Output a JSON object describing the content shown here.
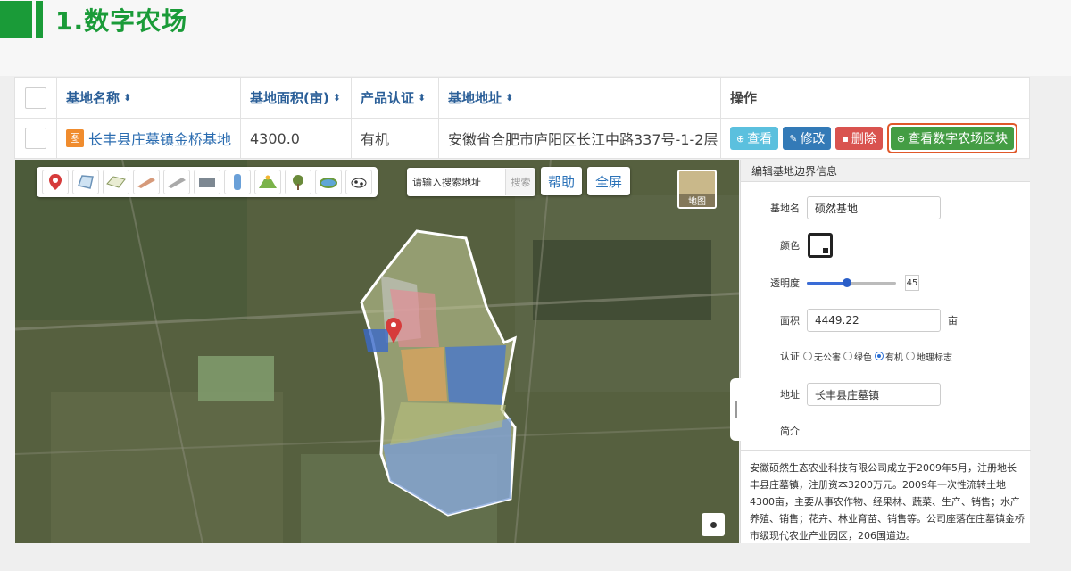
{
  "page": {
    "section_title": "1.数字农场"
  },
  "table": {
    "headers": {
      "name": "基地名称",
      "area": "基地面积(亩)",
      "cert": "产品认证",
      "address": "基地地址",
      "ops": "操作"
    },
    "sort_glyph": "⬍",
    "row": {
      "img_badge": "图",
      "name": "长丰县庄墓镇金桥基地",
      "area": "4300.0",
      "cert": "有机",
      "address": "安徽省合肥市庐阳区长江中路337号-1-2层"
    },
    "buttons": {
      "view": "查看",
      "edit": "修改",
      "delete": "删除",
      "view_farm": "查看数字农场区块"
    }
  },
  "map": {
    "search_placeholder": "请输入搜索地址",
    "search_button": "搜索",
    "help_button": "帮助",
    "fullscreen_button": "全屏",
    "layer_button": "地图",
    "tools": [
      "marker-tool",
      "polygon-tool",
      "field-tool",
      "greenhouse-tool",
      "shed-tool",
      "warehouse-tool",
      "tower-tool",
      "farmland-tool",
      "tree-tool",
      "pond-tool",
      "livestock-tool"
    ]
  },
  "panel": {
    "title": "编辑基地边界信息",
    "name_label": "基地名",
    "name_value": "硕然基地",
    "color_label": "颜色",
    "opacity_label": "透明度",
    "opacity_value": "45",
    "opacity_fraction": 0.45,
    "area_label": "面积",
    "area_value": "4449.22",
    "area_unit": "亩",
    "cert_label": "认证",
    "cert_options": [
      "无公害",
      "绿色",
      "有机",
      "地理标志"
    ],
    "cert_selected": "有机",
    "address_label": "地址",
    "address_value": "长丰县庄墓镇",
    "intro_label": "简介",
    "intro_text": "安徽硕然生态农业科技有限公司成立于2009年5月，注册地长丰县庄墓镇，注册资本3200万元。2009年一次性流转土地4300亩，主要从事农作物、经果林、蔬菜、生产、销售；水产养殖、销售；花卉、林业育苗、销售等。公司座落在庄墓镇金桥市级现代农业产业园区，206国道边。"
  },
  "colors": {
    "brand_green": "#1a9b38",
    "link_blue": "#2b6cb0",
    "btn_view": "#5bc0de",
    "btn_edit": "#337ab7",
    "btn_delete": "#d9534f",
    "btn_farm": "#449d44",
    "highlight_border": "#e0582a"
  }
}
